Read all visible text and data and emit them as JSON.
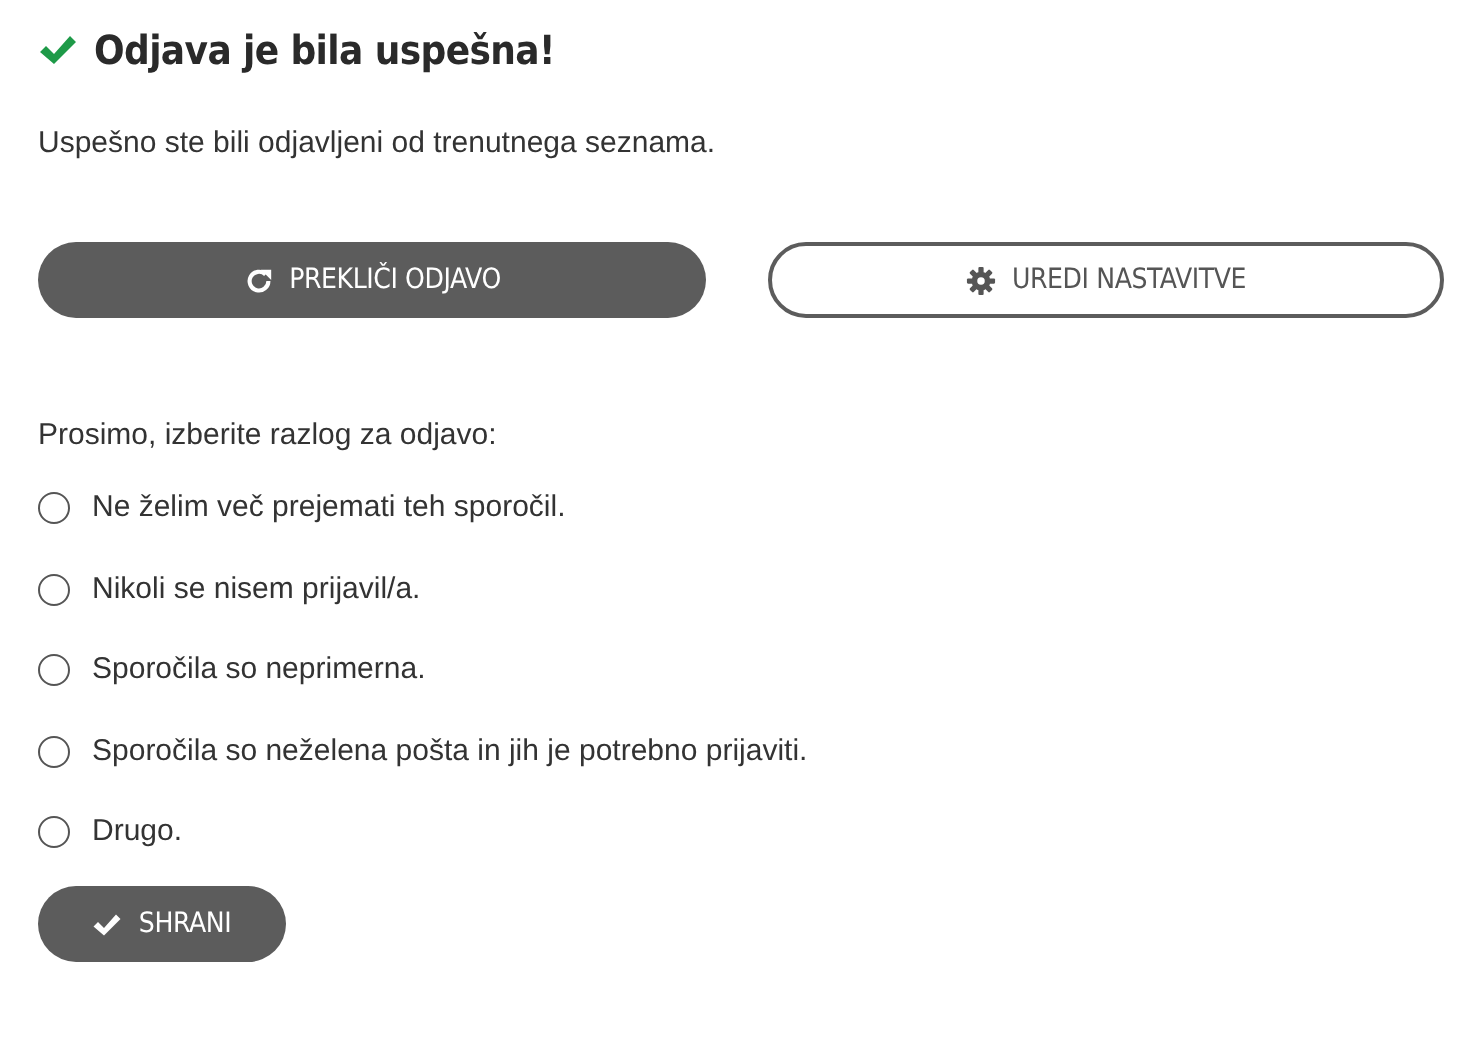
{
  "title": "Odjava je bila uspešna!",
  "message": "Uspešno ste bili odjavljeni od trenutnega seznama.",
  "actions": [
    {
      "label": "PREKLIČI ODJAVO",
      "kind": "filled"
    },
    {
      "label": "UREDI NASTAVITVE",
      "kind": "outline"
    }
  ],
  "reason_prompt": "Prosimo, izberite razlog za odjavo:",
  "reasons": [
    {
      "label": "Ne želim več prejemati teh sporočil.",
      "selected": false
    },
    {
      "label": "Nikoli se nisem prijavil/a.",
      "selected": false
    },
    {
      "label": "Sporočila so neprimerna.",
      "selected": false
    },
    {
      "label": "Sporočila so neželena pošta in jih je potrebno prijaviti.",
      "selected": false
    },
    {
      "label": "Drugo.",
      "selected": false
    }
  ],
  "save_button": {
    "label": "SHRANI"
  }
}
